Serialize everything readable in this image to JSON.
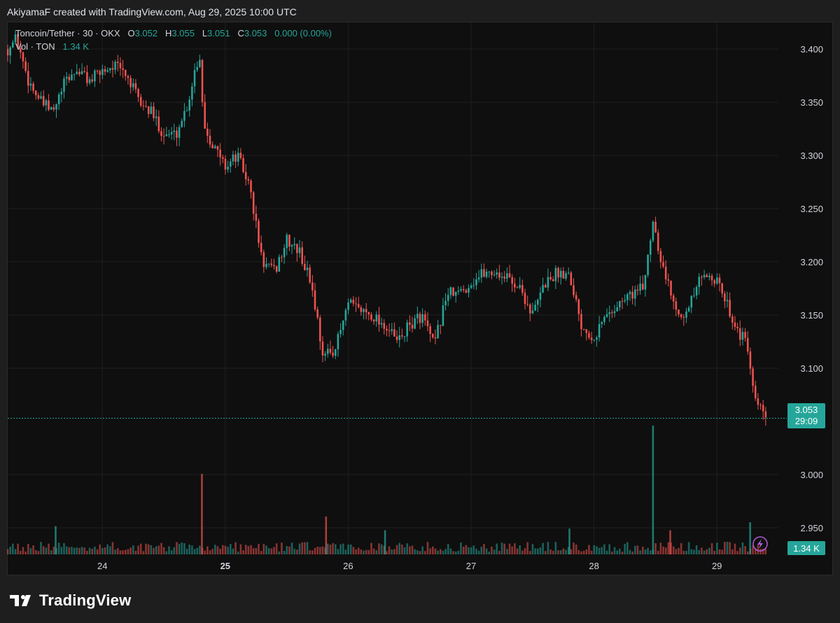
{
  "caption": "AkiyamaF created with TradingView.com, Aug 29, 2025 10:00 UTC",
  "brand": {
    "name": "TradingView"
  },
  "legend": {
    "symbol": "Toncoin/Tether · 30 · OKX",
    "o_label": "O",
    "o_value": "3.052",
    "h_label": "H",
    "h_value": "3.055",
    "l_label": "L",
    "l_value": "3.051",
    "c_label": "C",
    "c_value": "3.053",
    "change": "0.000 (0.00%)",
    "vol_label": "Vol · TON",
    "vol_value": "1.34 K"
  },
  "colors": {
    "up": "#26a69a",
    "down": "#ef5350",
    "grid": "#1f1f1f",
    "axis_text": "#d1d4dc"
  },
  "icons": {
    "lightning": "lightning-icon"
  },
  "chart_data": {
    "type": "candlestick",
    "interval": "30m",
    "x_tick_labels": [
      "24",
      "25",
      "26",
      "27",
      "28",
      "29"
    ],
    "x_tick_bold": [
      false,
      true,
      false,
      false,
      false,
      false
    ],
    "y_ticks": [
      "3.400",
      "3.350",
      "3.300",
      "3.250",
      "3.200",
      "3.150",
      "3.100",
      "3.000",
      "2.950"
    ],
    "ylim": [
      2.925,
      3.425
    ],
    "x_range_days": [
      23.23,
      29.5
    ],
    "current_price": "3.053",
    "countdown": "29:09",
    "volume_label": "1.34 K",
    "close_path": [
      [
        23.23,
        3.4
      ],
      [
        23.3,
        3.41
      ],
      [
        23.4,
        3.37
      ],
      [
        23.5,
        3.35
      ],
      [
        23.6,
        3.34
      ],
      [
        23.7,
        3.37
      ],
      [
        23.8,
        3.38
      ],
      [
        23.9,
        3.37
      ],
      [
        24.0,
        3.38
      ],
      [
        24.1,
        3.385
      ],
      [
        24.2,
        3.375
      ],
      [
        24.3,
        3.35
      ],
      [
        24.4,
        3.34
      ],
      [
        24.5,
        3.32
      ],
      [
        24.6,
        3.32
      ],
      [
        24.7,
        3.35
      ],
      [
        24.75,
        3.38
      ],
      [
        24.8,
        3.395
      ],
      [
        24.82,
        3.33
      ],
      [
        24.9,
        3.31
      ],
      [
        25.0,
        3.29
      ],
      [
        25.1,
        3.3
      ],
      [
        25.2,
        3.27
      ],
      [
        25.3,
        3.2
      ],
      [
        25.4,
        3.19
      ],
      [
        25.5,
        3.22
      ],
      [
        25.6,
        3.21
      ],
      [
        25.7,
        3.18
      ],
      [
        25.8,
        3.11
      ],
      [
        25.9,
        3.12
      ],
      [
        26.0,
        3.16
      ],
      [
        26.1,
        3.155
      ],
      [
        26.2,
        3.15
      ],
      [
        26.3,
        3.14
      ],
      [
        26.4,
        3.125
      ],
      [
        26.5,
        3.14
      ],
      [
        26.6,
        3.15
      ],
      [
        26.7,
        3.12
      ],
      [
        26.8,
        3.17
      ],
      [
        26.9,
        3.17
      ],
      [
        27.0,
        3.18
      ],
      [
        27.1,
        3.19
      ],
      [
        27.2,
        3.19
      ],
      [
        27.3,
        3.185
      ],
      [
        27.4,
        3.175
      ],
      [
        27.5,
        3.15
      ],
      [
        27.6,
        3.18
      ],
      [
        27.7,
        3.19
      ],
      [
        27.8,
        3.19
      ],
      [
        27.9,
        3.14
      ],
      [
        28.0,
        3.13
      ],
      [
        28.1,
        3.15
      ],
      [
        28.2,
        3.16
      ],
      [
        28.3,
        3.17
      ],
      [
        28.4,
        3.175
      ],
      [
        28.48,
        3.24
      ],
      [
        28.55,
        3.2
      ],
      [
        28.65,
        3.16
      ],
      [
        28.75,
        3.15
      ],
      [
        28.85,
        3.18
      ],
      [
        28.95,
        3.19
      ],
      [
        29.05,
        3.17
      ],
      [
        29.15,
        3.14
      ],
      [
        29.25,
        3.12
      ],
      [
        29.3,
        3.07
      ],
      [
        29.4,
        3.053
      ]
    ],
    "volume_spikes": [
      {
        "day": 24.81,
        "pct": 100,
        "dir": "down"
      },
      {
        "day": 28.48,
        "pct": 160,
        "dir": "up"
      },
      {
        "day": 25.82,
        "pct": 47,
        "dir": "down"
      },
      {
        "day": 29.27,
        "pct": 40,
        "dir": "up"
      },
      {
        "day": 23.62,
        "pct": 35,
        "dir": "up"
      },
      {
        "day": 26.3,
        "pct": 30,
        "dir": "up"
      },
      {
        "day": 27.8,
        "pct": 32,
        "dir": "up"
      },
      {
        "day": 28.62,
        "pct": 30,
        "dir": "down"
      }
    ]
  }
}
